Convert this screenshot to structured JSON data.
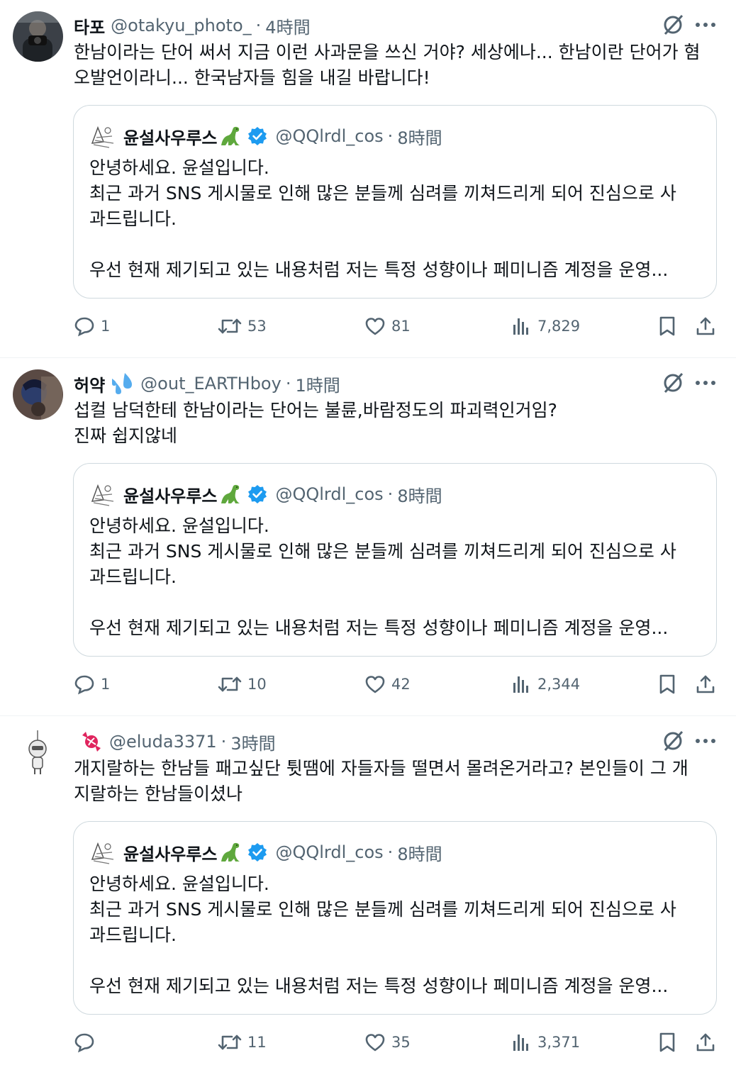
{
  "posts": [
    {
      "display_name": "타포",
      "handle": "@otakyu_photo_",
      "time": "4時間",
      "text": "한남이라는 단어 써서 지금 이런 사과문을 쓰신 거야? 세상에나... 한남이란 단어가 혐\n오발언이라니... 한국남자들 힘을 내길 바랍니다!",
      "quote": {
        "display_name": "윤설사우루스",
        "handle": "@QQlrdl_cos",
        "time": "8時間",
        "text": "안녕하세요. 윤설입니다.\n최근 과거 SNS 게시물로 인해 많은 분들께 심려를 끼쳐드리게 되어 진심으로 사\n과드립니다.\n\n우선 현재 제기되고 있는 내용처럼 저는 특정 성향이나 페미니즘 계정을 운영..."
      },
      "stats": {
        "replies": "1",
        "reposts": "53",
        "likes": "81",
        "views": "7,829"
      }
    },
    {
      "display_name": "허약",
      "handle": "@out_EARTHboy",
      "time": "1時間",
      "text": "섭컬 남덕한테 한남이라는 단어는 불륜,바람정도의 파괴력인거임?\n진짜 쉽지않네",
      "quote": {
        "display_name": "윤설사우루스",
        "handle": "@QQlrdl_cos",
        "time": "8時間",
        "text": "안녕하세요. 윤설입니다.\n최근 과거 SNS 게시물로 인해 많은 분들께 심려를 끼쳐드리게 되어 진심으로 사\n과드립니다.\n\n우선 현재 제기되고 있는 내용처럼 저는 특정 성향이나 페미니즘 계정을 운영..."
      },
      "stats": {
        "replies": "1",
        "reposts": "10",
        "likes": "42",
        "views": "2,344"
      }
    },
    {
      "display_name": "",
      "handle": "@eluda3371",
      "time": "3時間",
      "text": "개지랄하는 한남들 패고싶단 튓땜에 자들자들 떨면서 몰려온거라고? 본인들이 그 개\n지랄하는 한남들이셨나",
      "quote": {
        "display_name": "윤설사우루스",
        "handle": "@QQlrdl_cos",
        "time": "8時間",
        "text": "안녕하세요. 윤설입니다.\n최근 과거 SNS 게시물로 인해 많은 분들께 심려를 끼쳐드리게 되어 진심으로 사\n과드립니다.\n\n우선 현재 제기되고 있는 내용처럼 저는 특정 성향이나 페미니즘 계정을 운영..."
      },
      "stats": {
        "replies": "",
        "reposts": "11",
        "likes": "35",
        "views": "3,371"
      }
    }
  ],
  "separator": "·",
  "icons": {
    "reply": "reply-icon",
    "repost": "repost-icon",
    "like": "heart-icon",
    "views": "views-icon",
    "bookmark": "bookmark-icon",
    "share": "share-icon",
    "grok": "grok-icon",
    "more": "more-icon",
    "verified": "verified-badge-icon"
  },
  "colors": {
    "text": "#0f1419",
    "secondary": "#536471",
    "border": "#cfd9de",
    "divider": "#eff3f4",
    "verified": "#1d9bf0"
  }
}
